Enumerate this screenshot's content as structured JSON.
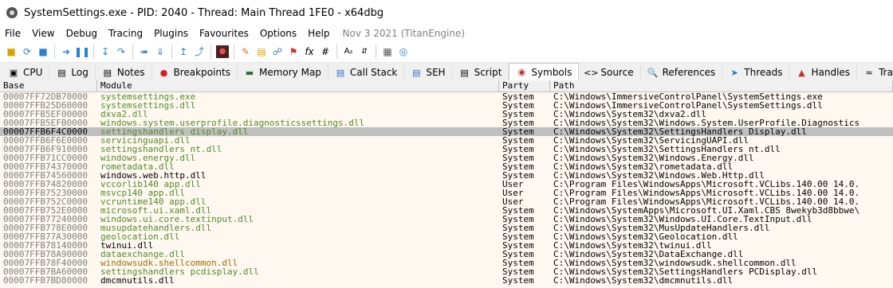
{
  "window": {
    "title": "SystemSettings.exe - PID: 2040 - Thread: Main Thread 1FE0 - x64dbg"
  },
  "menu": {
    "items": [
      "File",
      "View",
      "Debug",
      "Tracing",
      "Plugins",
      "Favourites",
      "Options",
      "Help"
    ],
    "build_date": "Nov 3 2021 (TitanEngine)"
  },
  "tabs": [
    {
      "label": "CPU",
      "icon": "cpu-icon"
    },
    {
      "label": "Log",
      "icon": "log-icon"
    },
    {
      "label": "Notes",
      "icon": "notes-icon"
    },
    {
      "label": "Breakpoints",
      "icon": "breakpoint-icon"
    },
    {
      "label": "Memory Map",
      "icon": "memory-icon"
    },
    {
      "label": "Call Stack",
      "icon": "callstack-icon"
    },
    {
      "label": "SEH",
      "icon": "seh-icon"
    },
    {
      "label": "Script",
      "icon": "script-icon"
    },
    {
      "label": "Symbols",
      "icon": "symbols-icon"
    },
    {
      "label": "Source",
      "icon": "source-icon"
    },
    {
      "label": "References",
      "icon": "references-icon"
    },
    {
      "label": "Threads",
      "icon": "threads-icon"
    },
    {
      "label": "Handles",
      "icon": "handles-icon"
    },
    {
      "label": "Trace",
      "icon": "trace-icon"
    }
  ],
  "active_tab": "Symbols",
  "colors": {
    "user_module": "#4f8b2a",
    "system_module": "#000000",
    "highlight_module": "#a06a00",
    "selected_row": "#c0c0c0"
  },
  "table": {
    "headers": [
      "Base",
      "Module",
      "Party",
      "Path"
    ],
    "rows": [
      {
        "base": "00007FF72DB70000",
        "module": "systemsettings.exe",
        "party": "System",
        "path": "C:\\Windows\\ImmersiveControlPanel\\SystemSettings.exe",
        "color": "green"
      },
      {
        "base": "00007FFB25D60000",
        "module": "systemsettings.dll",
        "party": "System",
        "path": "C:\\Windows\\ImmersiveControlPanel\\SystemSettings.dll",
        "color": "green"
      },
      {
        "base": "00007FFB5EF00000",
        "module": "dxva2.dll",
        "party": "System",
        "path": "C:\\Windows\\System32\\dxva2.dll",
        "color": "green"
      },
      {
        "base": "00007FFB5EFB0000",
        "module": "windows.system.userprofile.diagnosticssettings.dll",
        "party": "System",
        "path": "C:\\Windows\\System32\\Windows.System.UserProfile.Diagnostics",
        "color": "green"
      },
      {
        "base": "00007FFB6F4C0000",
        "module": "settingshandlers_display.dll",
        "party": "System",
        "path": "C:\\Windows\\System32\\SettingsHandlers_Display.dll",
        "color": "green",
        "selected": true
      },
      {
        "base": "00007FFB6F6E0000",
        "module": "servicinguapi.dll",
        "party": "System",
        "path": "C:\\Windows\\System32\\ServicingUAPI.dll",
        "color": "green"
      },
      {
        "base": "00007FFB6F910000",
        "module": "settingshandlers_nt.dll",
        "party": "System",
        "path": "C:\\Windows\\System32\\SettingsHandlers_nt.dll",
        "color": "green"
      },
      {
        "base": "00007FFB71CC0000",
        "module": "windows.energy.dll",
        "party": "System",
        "path": "C:\\Windows\\System32\\Windows.Energy.dll",
        "color": "green"
      },
      {
        "base": "00007FFB74370000",
        "module": "rometadata.dll",
        "party": "System",
        "path": "C:\\Windows\\System32\\rometadata.dll",
        "color": "green"
      },
      {
        "base": "00007FFB74560000",
        "module": "windows.web.http.dll",
        "party": "System",
        "path": "C:\\Windows\\System32\\Windows.Web.Http.dll",
        "color": "black"
      },
      {
        "base": "00007FFB74820000",
        "module": "vccorlib140_app.dll",
        "party": "User",
        "path": "C:\\Program Files\\WindowsApps\\Microsoft.VCLibs.140.00_14.0.",
        "color": "green"
      },
      {
        "base": "00007FFB75230000",
        "module": "msvcp140_app.dll",
        "party": "User",
        "path": "C:\\Program Files\\WindowsApps\\Microsoft.VCLibs.140.00_14.0.",
        "color": "green"
      },
      {
        "base": "00007FFB752C0000",
        "module": "vcruntime140_app.dll",
        "party": "User",
        "path": "C:\\Program Files\\WindowsApps\\Microsoft.VCLibs.140.00_14.0.",
        "color": "green"
      },
      {
        "base": "00007FFB752E0000",
        "module": "microsoft.ui.xaml.dll",
        "party": "System",
        "path": "C:\\Windows\\SystemApps\\Microsoft.UI.Xaml.CBS_8wekyb3d8bbwe\\",
        "color": "green"
      },
      {
        "base": "00007FFB77240000",
        "module": "windows.ui.core.textinput.dll",
        "party": "System",
        "path": "C:\\Windows\\System32\\Windows.UI.Core.TextInput.dll",
        "color": "green"
      },
      {
        "base": "00007FFB778E0000",
        "module": "musupdatehandlers.dll",
        "party": "System",
        "path": "C:\\Windows\\System32\\MusUpdateHandlers.dll",
        "color": "green"
      },
      {
        "base": "00007FFB77A30000",
        "module": "geolocation.dll",
        "party": "System",
        "path": "C:\\Windows\\System32\\Geolocation.dll",
        "color": "green"
      },
      {
        "base": "00007FFB78140000",
        "module": "twinui.dll",
        "party": "System",
        "path": "C:\\Windows\\System32\\twinui.dll",
        "color": "black"
      },
      {
        "base": "00007FFB78A90000",
        "module": "dataexchange.dll",
        "party": "System",
        "path": "C:\\Windows\\System32\\DataExchange.dll",
        "color": "green"
      },
      {
        "base": "00007FFB78F40000",
        "module": "windowsudk.shellcommon.dll",
        "party": "System",
        "path": "C:\\Windows\\System32\\windowsudk.shellcommon.dll",
        "color": "brown"
      },
      {
        "base": "00007FFB7BA60000",
        "module": "settingshandlers_pcdisplay.dll",
        "party": "System",
        "path": "C:\\Windows\\System32\\SettingsHandlers_PCDisplay.dll",
        "color": "green"
      },
      {
        "base": "00007FFB7BD80000",
        "module": "dmcmnutils.dll",
        "party": "System",
        "path": "C:\\Windows\\System32\\dmcmnutils.dll",
        "color": "black"
      }
    ]
  }
}
